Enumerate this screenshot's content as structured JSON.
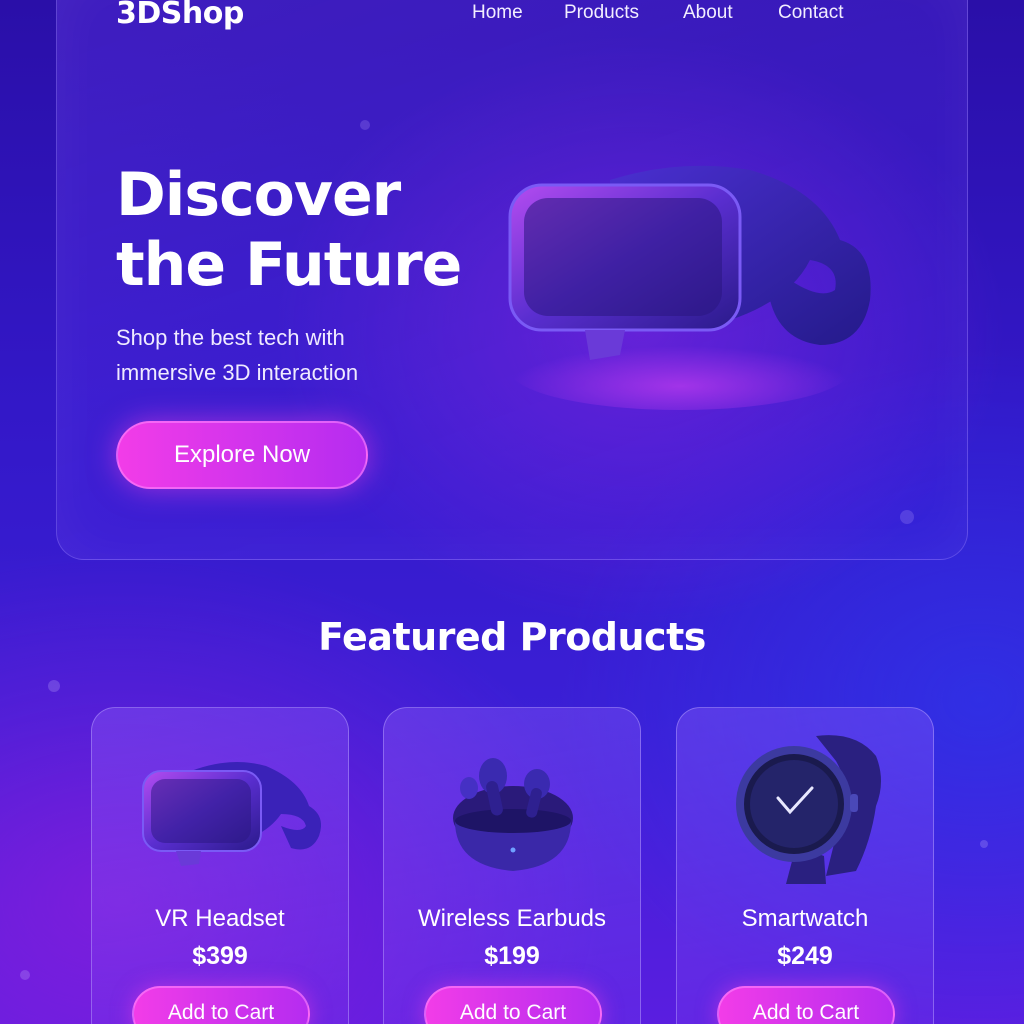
{
  "header": {
    "logo": "3DShop",
    "nav": [
      {
        "label": "Home"
      },
      {
        "label": "Products"
      },
      {
        "label": "About"
      },
      {
        "label": "Contact"
      }
    ]
  },
  "hero": {
    "headline_line1": "Discover",
    "headline_line2": "the Future",
    "subtext_line1": "Shop the best tech with",
    "subtext_line2": "immersive 3D interaction",
    "cta_label": "Explore Now",
    "image_icon": "vr-headset-icon"
  },
  "featured": {
    "title": "Featured Products",
    "products": [
      {
        "name": "VR Headset",
        "price": "$399",
        "button": "Add to Cart",
        "icon": "vr-headset-icon"
      },
      {
        "name": "Wireless Earbuds",
        "price": "$199",
        "button": "Add to Cart",
        "icon": "earbuds-icon"
      },
      {
        "name": "Smartwatch",
        "price": "$249",
        "button": "Add to Cart",
        "icon": "smartwatch-icon"
      }
    ]
  },
  "colors": {
    "accent": "#f23ce8",
    "background_top": "#2a0fa8",
    "background_bottom": "#5a1ee0"
  }
}
